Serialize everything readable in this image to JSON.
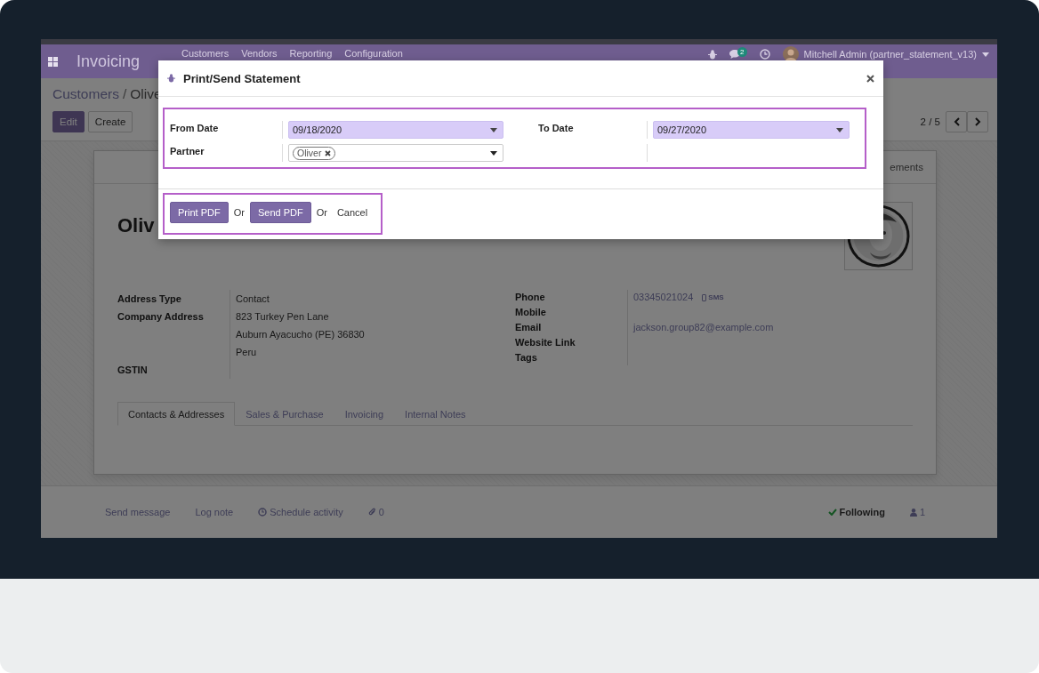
{
  "navbar": {
    "app_name": "Invoicing",
    "menu": [
      "Customers",
      "Vendors",
      "Reporting",
      "Configuration"
    ],
    "messages_badge": "2",
    "user": "Mitchell Admin (partner_statement_v13)"
  },
  "breadcrumb": {
    "links": [
      "Customers"
    ],
    "separator": "/",
    "current": "Olive"
  },
  "buttons": [
    {
      "label": "Edit",
      "kind": "primary"
    },
    {
      "label": "Create",
      "kind": "secondary"
    }
  ],
  "pager": "2 / 5",
  "form": {
    "button_box": "ements",
    "name": "Oliv",
    "left_fields": [
      {
        "label": "Address Type",
        "lines": [
          "Contact"
        ]
      },
      {
        "label": "Company Address",
        "lines": [
          "823 Turkey Pen Lane",
          "Auburn  Ayacucho (PE)  36830",
          "Peru"
        ]
      },
      {
        "label": "GSTIN"
      }
    ],
    "right_fields": [
      {
        "label": "Phone",
        "value": "03345021024",
        "action": "SMS"
      },
      {
        "label": "Mobile"
      },
      {
        "label": "Email",
        "value": "jackson.group82@example.com"
      },
      {
        "label": "Website Link"
      },
      {
        "label": "Tags"
      }
    ],
    "tabs": [
      {
        "label": "Contacts & Addresses",
        "selected": true
      },
      {
        "label": "Sales & Purchase",
        "selected": false
      },
      {
        "label": "Invoicing",
        "selected": false
      },
      {
        "label": "Internal Notes",
        "selected": false
      }
    ]
  },
  "chatter": {
    "send_message": "Send message",
    "log_note": "Log note",
    "schedule_activity": "Schedule activity",
    "attachments": "0",
    "follow": "Following",
    "followers": "1"
  },
  "dialog": {
    "title": "Print/Send Statement",
    "from_date": {
      "label": "From Date",
      "value": "09/18/2020"
    },
    "to_date": {
      "label": "To Date",
      "value": "09/27/2020"
    },
    "partner": {
      "label": "Partner",
      "tags": [
        "Oliver"
      ]
    },
    "footer": [
      {
        "kind": "primary",
        "label": "Print PDF"
      },
      {
        "kind": "text",
        "label": "Or"
      },
      {
        "kind": "primary",
        "label": "Send PDF"
      },
      {
        "kind": "text",
        "label": "Or"
      },
      {
        "kind": "link",
        "label": "Cancel"
      }
    ]
  }
}
